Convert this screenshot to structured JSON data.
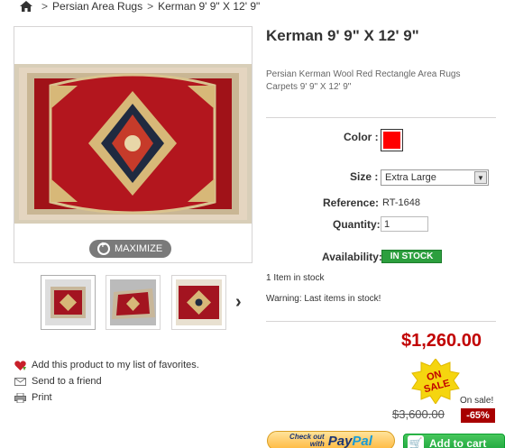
{
  "breadcrumb": {
    "home_icon": "home-icon",
    "items": [
      "Persian Area Rugs",
      "Kerman 9' 9\" X 12' 9\""
    ]
  },
  "gallery": {
    "maximize_label": "MAXIMIZE",
    "thumbnails": 3
  },
  "left_links": {
    "favorites": "Add this product to my list of favorites.",
    "send": "Send to a friend",
    "print": "Print"
  },
  "product": {
    "title": "Kerman 9' 9\" X 12' 9\"",
    "description": "Persian Kerman Wool Red Rectangle Area Rugs Carpets 9' 9\" X 12' 9\"",
    "color_label": "Color :",
    "color_value": "#ff0000",
    "size_label": "Size :",
    "size_value": "Extra Large",
    "reference_label": "Reference:",
    "reference_value": "RT-1648",
    "quantity_label": "Quantity:",
    "quantity_value": "1",
    "availability_label": "Availability:",
    "availability_value": "IN STOCK",
    "stock_count": "1 Item in stock",
    "warning": "Warning: Last items in stock!"
  },
  "pricing": {
    "price": "$1,260.00",
    "badge_line1": "ON",
    "badge_line2": "SALE",
    "on_sale": "On sale!",
    "old_price": "$3,600.00",
    "discount": "-65%"
  },
  "buttons": {
    "paypal_small_1": "Check out",
    "paypal_small_2": "with",
    "paypal_brand_1": "Pay",
    "paypal_brand_2": "Pal",
    "add_to_cart": "Add to cart"
  }
}
